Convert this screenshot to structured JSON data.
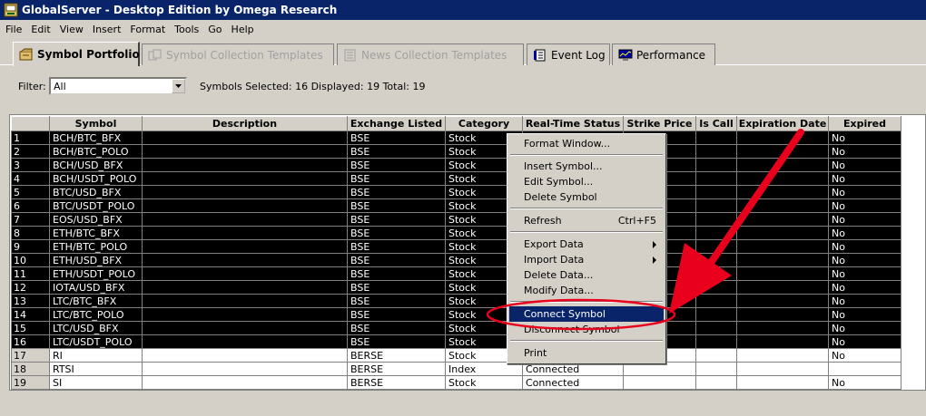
{
  "window": {
    "title": "GlobalServer - Desktop Edition by Omega Research"
  },
  "menubar": [
    "File",
    "Edit",
    "View",
    "Insert",
    "Format",
    "Tools",
    "Go",
    "Help"
  ],
  "tabs": [
    {
      "label": "Symbol Portfolio",
      "icon": "portfolio-icon",
      "state": "active"
    },
    {
      "label": "Symbol Collection Templates",
      "icon": "collection-icon",
      "state": "disabled"
    },
    {
      "label": "News Collection Templates",
      "icon": "news-icon",
      "state": "disabled"
    },
    {
      "label": "Event Log",
      "icon": "log-icon",
      "state": "normal"
    },
    {
      "label": "Performance",
      "icon": "monitor-icon",
      "state": "normal"
    }
  ],
  "filter": {
    "label": "Filter:",
    "value": "All"
  },
  "status": "Symbols  Selected: 16  Displayed: 19  Total: 19",
  "columns": [
    "Symbol",
    "Description",
    "Exchange Listed",
    "Category",
    "Real-Time Status",
    "Strike Price",
    "Is Call",
    "Expiration Date",
    "Expired"
  ],
  "rows": [
    {
      "n": "1",
      "symbol": "BCH/BTC_BFX",
      "exchange": "BSE",
      "category": "Stock",
      "status": "",
      "expired": "No",
      "selected": true
    },
    {
      "n": "2",
      "symbol": "BCH/BTC_POLO",
      "exchange": "BSE",
      "category": "Stock",
      "status": "",
      "expired": "No",
      "selected": true
    },
    {
      "n": "3",
      "symbol": "BCH/USD_BFX",
      "exchange": "BSE",
      "category": "Stock",
      "status": "",
      "expired": "No",
      "selected": true
    },
    {
      "n": "4",
      "symbol": "BCH/USDT_POLO",
      "exchange": "BSE",
      "category": "Stock",
      "status": "",
      "expired": "No",
      "selected": true
    },
    {
      "n": "5",
      "symbol": "BTC/USD_BFX",
      "exchange": "BSE",
      "category": "Stock",
      "status": "",
      "expired": "No",
      "selected": true
    },
    {
      "n": "6",
      "symbol": "BTC/USDT_POLO",
      "exchange": "BSE",
      "category": "Stock",
      "status": "",
      "expired": "No",
      "selected": true
    },
    {
      "n": "7",
      "symbol": "EOS/USD_BFX",
      "exchange": "BSE",
      "category": "Stock",
      "status": "",
      "expired": "No",
      "selected": true
    },
    {
      "n": "8",
      "symbol": "ETH/BTC_BFX",
      "exchange": "BSE",
      "category": "Stock",
      "status": "",
      "expired": "No",
      "selected": true
    },
    {
      "n": "9",
      "symbol": "ETH/BTC_POLO",
      "exchange": "BSE",
      "category": "Stock",
      "status": "",
      "expired": "No",
      "selected": true
    },
    {
      "n": "10",
      "symbol": "ETH/USD_BFX",
      "exchange": "BSE",
      "category": "Stock",
      "status": "",
      "expired": "No",
      "selected": true
    },
    {
      "n": "11",
      "symbol": "ETH/USDT_POLO",
      "exchange": "BSE",
      "category": "Stock",
      "status": "",
      "expired": "No",
      "selected": true
    },
    {
      "n": "12",
      "symbol": "IOTA/USD_BFX",
      "exchange": "BSE",
      "category": "Stock",
      "status": "",
      "expired": "No",
      "selected": true
    },
    {
      "n": "13",
      "symbol": "LTC/BTC_BFX",
      "exchange": "BSE",
      "category": "Stock",
      "status": "",
      "expired": "No",
      "selected": true
    },
    {
      "n": "14",
      "symbol": "LTC/BTC_POLO",
      "exchange": "BSE",
      "category": "Stock",
      "status": "",
      "expired": "No",
      "selected": true
    },
    {
      "n": "15",
      "symbol": "LTC/USD_BFX",
      "exchange": "BSE",
      "category": "Stock",
      "status": "",
      "expired": "No",
      "selected": true
    },
    {
      "n": "16",
      "symbol": "LTC/USDT_POLO",
      "exchange": "BSE",
      "category": "Stock",
      "status": "",
      "expired": "No",
      "selected": true
    },
    {
      "n": "17",
      "symbol": "RI",
      "exchange": "BERSE",
      "category": "Stock",
      "status": "",
      "expired": "No",
      "selected": false
    },
    {
      "n": "18",
      "symbol": "RTSI",
      "exchange": "BERSE",
      "category": "Index",
      "status": "Connected",
      "expired": "",
      "selected": false
    },
    {
      "n": "19",
      "symbol": "SI",
      "exchange": "BERSE",
      "category": "Stock",
      "status": "Connected",
      "expired": "No",
      "selected": false
    }
  ],
  "context_menu": {
    "format_window": "Format Window...",
    "insert_symbol": "Insert Symbol...",
    "edit_symbol": "Edit Symbol...",
    "delete_symbol": "Delete Symbol",
    "refresh": "Refresh",
    "refresh_shortcut": "Ctrl+F5",
    "export_data": "Export Data",
    "import_data": "Import Data",
    "delete_data": "Delete Data...",
    "modify_data": "Modify Data...",
    "connect_symbol": "Connect Symbol",
    "disconnect_symbol": "Disconnect Symbol",
    "print": "Print"
  },
  "annotation_color": "#e8001c"
}
